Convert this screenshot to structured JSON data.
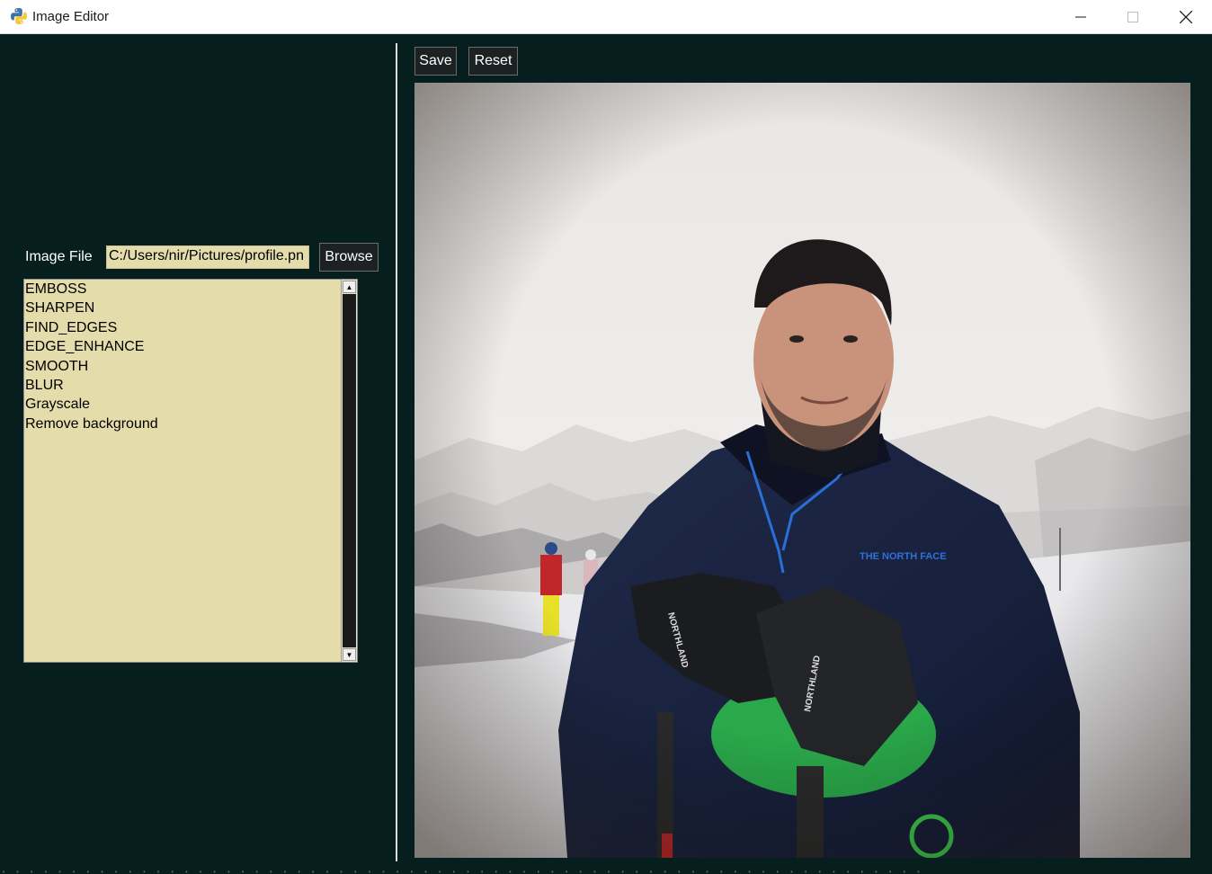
{
  "window": {
    "title": "Image Editor",
    "icon": "python-icon"
  },
  "toolbar": {
    "save_label": "Save",
    "reset_label": "Reset"
  },
  "file": {
    "label": "Image File",
    "value": "C:/Users/nir/Pictures/profile.pn",
    "browse_label": "Browse"
  },
  "filters": {
    "items": [
      "EMBOSS",
      "SHARPEN",
      "FIND_EDGES",
      "EDGE_ENHANCE",
      "SMOOTH",
      "BLUR",
      "Grayscale",
      "Remove background"
    ]
  },
  "colors": {
    "background": "#071e1e",
    "listbox": "#e5dcac",
    "button": "#1c2222"
  }
}
